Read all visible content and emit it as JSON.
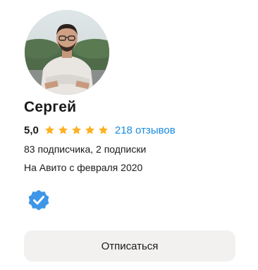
{
  "profile": {
    "name": "Сергей",
    "rating": "5,0",
    "stars_filled": 5,
    "stars_total": 5,
    "reviews_label": "218 отзывов",
    "subscribers_label": "83 подписчика, 2 подписки",
    "member_since_label": "На Авито с февраля 2020",
    "verified": true
  },
  "actions": {
    "unsubscribe_label": "Отписаться"
  },
  "icons": {
    "star": "star-icon",
    "verified": "verified-badge-icon"
  },
  "colors": {
    "star": "#ffb021",
    "link": "#1a8be0",
    "verified_badge": "#3d96e8",
    "button_bg": "#f2f1f0"
  }
}
